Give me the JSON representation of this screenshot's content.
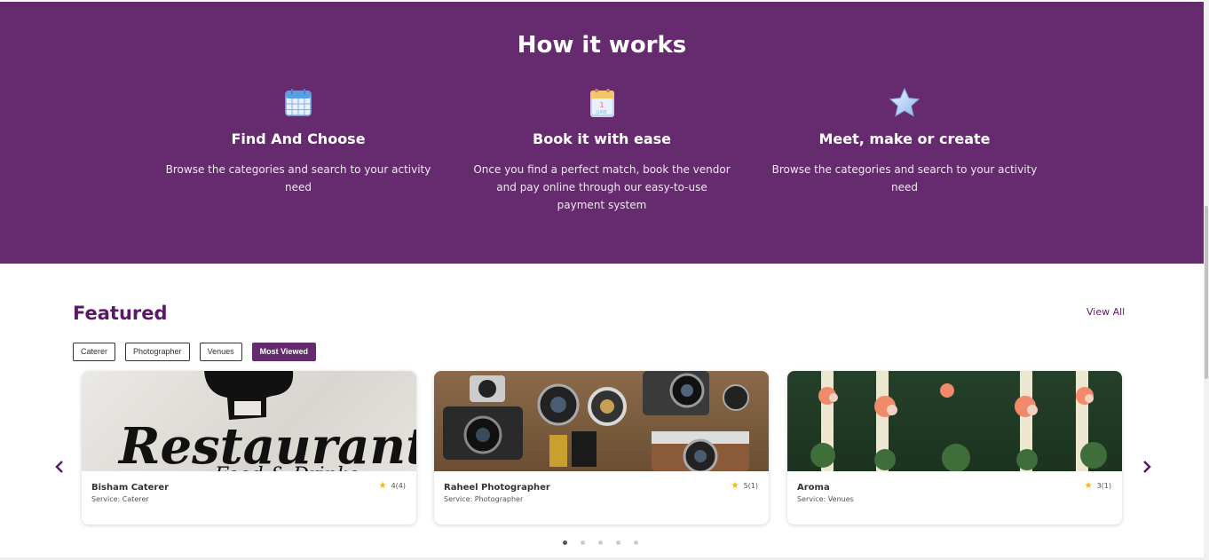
{
  "how_it_works": {
    "title": "How it works",
    "steps": [
      {
        "icon": "calendar-grid-icon",
        "title": "Find And Choose",
        "desc": "Browse the categories and search to your activity need"
      },
      {
        "icon": "calendar-june-icon",
        "title": "Book it with ease",
        "desc": "Once you find a perfect match, book the vendor and pay online through our easy-to-use payment system"
      },
      {
        "icon": "star-icon",
        "title": "Meet, make or create",
        "desc": "Browse the categories and search to your activity need"
      }
    ]
  },
  "featured": {
    "title": "Featured",
    "view_all": "View All",
    "filters": [
      "Caterer",
      "Photographer",
      "Venues",
      "Most Viewed"
    ],
    "active_filter": "Most Viewed",
    "cards": [
      {
        "name": "Bisham Caterer",
        "service": "Service: Caterer",
        "rating": "4(4)",
        "image_text": "Restaurant",
        "image_subtext": "Food & Drinks"
      },
      {
        "name": "Raheel Photographer",
        "service": "Service: Photographer",
        "rating": "5(1)"
      },
      {
        "name": "Aroma",
        "service": "Service: Venues",
        "rating": "3(1)"
      }
    ],
    "carousel_pages": 5,
    "active_page": 1
  },
  "colors": {
    "brand": "#662a6f",
    "accent_text": "#5a1a66",
    "star": "#f4b400"
  }
}
